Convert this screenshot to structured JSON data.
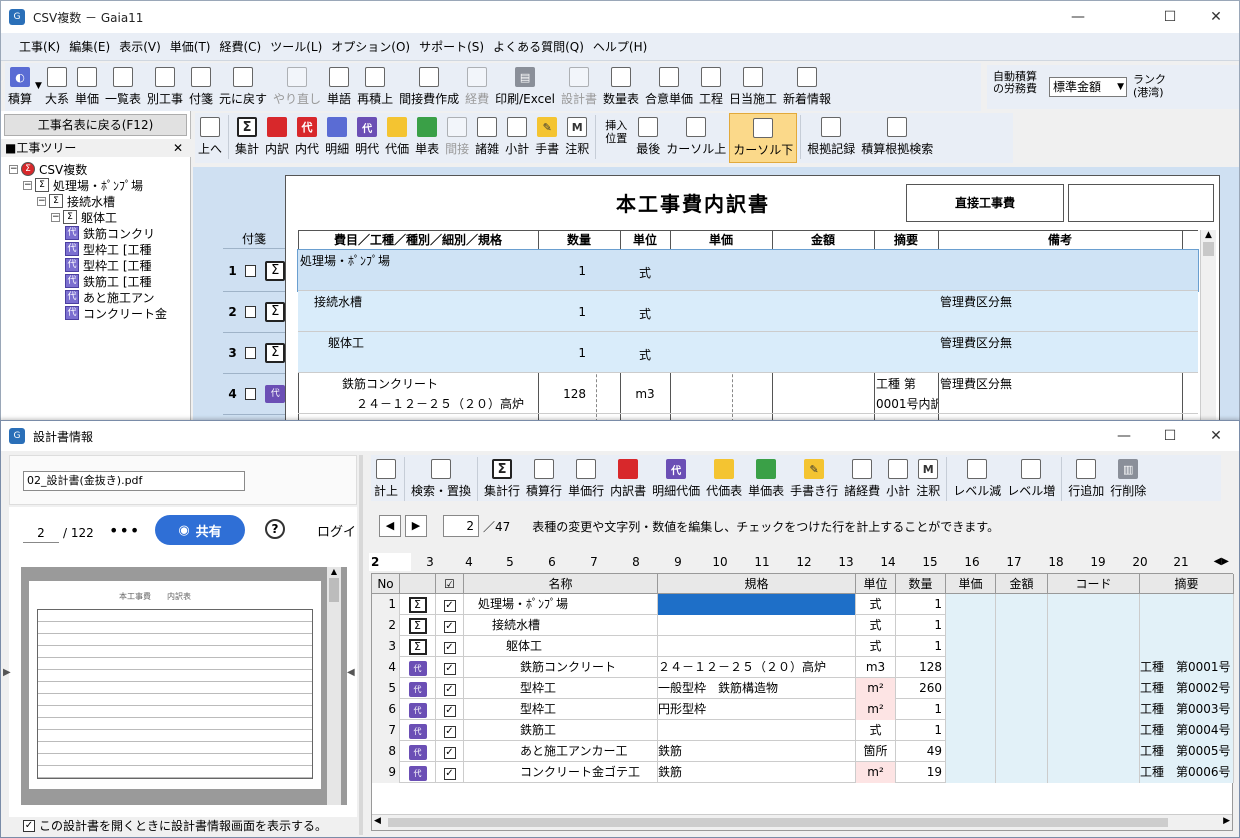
{
  "main_window": {
    "title": "CSV複数 － Gaia11",
    "menus": [
      "工事(K)",
      "編集(E)",
      "表示(V)",
      "単価(T)",
      "経費(C)",
      "ツール(L)",
      "オプション(O)",
      "サポート(S)",
      "よくある質問(Q)",
      "ヘルプ(H)"
    ],
    "toolbar1": [
      {
        "label": "積算",
        "icon": "globe-icon"
      },
      {
        "label": "大系",
        "icon": "tree-icon"
      },
      {
        "label": "単価",
        "icon": "price-icon"
      },
      {
        "label": "一覧表",
        "icon": "list-icon"
      },
      {
        "label": "別工事",
        "icon": "other-work-icon"
      },
      {
        "label": "付箋",
        "icon": "sticky-note-icon"
      },
      {
        "label": "元に戻す",
        "icon": "undo-icon"
      },
      {
        "label": "やり直し",
        "icon": "redo-icon",
        "disabled": true
      },
      {
        "label": "単語",
        "icon": "word-icon"
      },
      {
        "label": "再積上",
        "icon": "recalc-icon"
      },
      {
        "label": "間接費作成",
        "icon": "indirect-cost-icon"
      },
      {
        "label": "経費",
        "icon": "expense-icon",
        "disabled": true
      },
      {
        "label": "印刷/Excel",
        "icon": "printer-icon"
      },
      {
        "label": "設計書",
        "icon": "design-doc-icon",
        "disabled": true
      },
      {
        "label": "数量表",
        "icon": "quantity-table-icon"
      },
      {
        "label": "合意単価",
        "icon": "agreed-price-icon"
      },
      {
        "label": "工程",
        "icon": "schedule-icon"
      },
      {
        "label": "日当施工",
        "icon": "daily-work-icon"
      },
      {
        "label": "新着情報",
        "icon": "news-icon"
      }
    ],
    "auto_labor": {
      "label": "自動積算の労務費",
      "select_value": "標準金額",
      "rank_label": "ランク(港湾)"
    },
    "back_button": "工事名表に戻る(F12)",
    "tree_header": "■工事ツリー",
    "tree": [
      {
        "label": "CSV複数",
        "level": 0
      },
      {
        "label": "処理場・ﾎﾟﾝﾌﾟ場",
        "level": 1
      },
      {
        "label": "接続水槽",
        "level": 2
      },
      {
        "label": "躯体工",
        "level": 3
      },
      {
        "label": "鉄筋コンクリ",
        "level": 4
      },
      {
        "label": "型枠工 [工種",
        "level": 4
      },
      {
        "label": "型枠工 [工種",
        "level": 4
      },
      {
        "label": "鉄筋工 [工種",
        "level": 4
      },
      {
        "label": "あと施工アン",
        "level": 4
      },
      {
        "label": "コンクリート金",
        "level": 4
      }
    ],
    "toolbar2": [
      {
        "label": "上へ",
        "icon": "up-folder-icon"
      },
      {
        "label": "集計",
        "icon": "sigma-icon"
      },
      {
        "label": "内訳",
        "icon": "red-folder-icon"
      },
      {
        "label": "内代",
        "icon": "red-dai-icon"
      },
      {
        "label": "明細",
        "icon": "blue-folder-icon"
      },
      {
        "label": "明代",
        "icon": "blue-dai-icon"
      },
      {
        "label": "代価",
        "icon": "yellow-folder-icon"
      },
      {
        "label": "単表",
        "icon": "green-folder-icon"
      },
      {
        "label": "間接",
        "icon": "indirect-icon",
        "disabled": true
      },
      {
        "label": "諸雑",
        "icon": "misc-icon"
      },
      {
        "label": "小計",
        "icon": "subtotal-icon"
      },
      {
        "label": "手書",
        "icon": "pencil-icon"
      },
      {
        "label": "注釈",
        "icon": "memo-icon"
      },
      {
        "label": "挿入位置",
        "icon": ""
      },
      {
        "label": "最後",
        "icon": "last-icon"
      },
      {
        "label": "カーソル上",
        "icon": "cursor-up-icon"
      },
      {
        "label": "カーソル下",
        "icon": "cursor-down-icon",
        "active": true
      },
      {
        "label": "根拠記録",
        "icon": "evidence-icon"
      },
      {
        "label": "積算根拠検索",
        "icon": "evidence-search-icon"
      }
    ],
    "sheet": {
      "title": "本工事費内訳書",
      "box_label": "直接工事費",
      "fusen_label": "付箋",
      "headers": [
        "費目／工種／種別／細別／規格",
        "数量",
        "単位",
        "単価",
        "金額",
        "摘要",
        "備考"
      ],
      "rows": [
        {
          "no": "1",
          "name": "処理場・ﾎﾟﾝﾌﾟ場",
          "qty": "1",
          "unit": "式",
          "tekiyo": "",
          "biko": "",
          "icon": "sigma"
        },
        {
          "no": "2",
          "name": "接続水槽",
          "qty": "1",
          "unit": "式",
          "tekiyo": "",
          "biko": "管理費区分無",
          "icon": "sigma"
        },
        {
          "no": "3",
          "name": "躯体工",
          "qty": "1",
          "unit": "式",
          "tekiyo": "",
          "biko": "管理費区分無",
          "icon": "sigma"
        },
        {
          "no": "4",
          "name": "鉄筋コンクリート",
          "name2": "２４－１２－２５（２０）高炉",
          "qty": "128",
          "unit": "m3",
          "tekiyo": "工種 第",
          "tekiyo2": "0001号内訳",
          "biko": "管理費区分無",
          "icon": "dai"
        }
      ]
    }
  },
  "dialog": {
    "title": "設計書情報",
    "pdf_name": "02_設計書(金抜き).pdf",
    "page_current": "2",
    "page_total": "/ 122",
    "share_label": "共有",
    "login_label": "ログイ",
    "pdf_heading": "本工事費　　内訳表",
    "footer_checkbox": "この設計書を開くときに設計書情報画面を表示する。",
    "toolbar": [
      {
        "label": "計上",
        "icon": "post-icon"
      },
      {
        "label": "検索・置換",
        "icon": "search-replace-icon"
      },
      {
        "label": "集計行",
        "icon": "sigma-icon"
      },
      {
        "label": "積算行",
        "icon": "calc-row-icon"
      },
      {
        "label": "単価行",
        "icon": "price-row-icon"
      },
      {
        "label": "内訳書",
        "icon": "red-folder-icon"
      },
      {
        "label": "明細代価",
        "icon": "blue-dai-icon"
      },
      {
        "label": "代価表",
        "icon": "yellow-folder-icon"
      },
      {
        "label": "単価表",
        "icon": "green-folder-icon"
      },
      {
        "label": "手書き行",
        "icon": "pencil-icon"
      },
      {
        "label": "諸経費",
        "icon": "misc-icon"
      },
      {
        "label": "小計",
        "icon": "subtotal-icon"
      },
      {
        "label": "注釈",
        "icon": "memo-icon"
      },
      {
        "label": "レベル減",
        "icon": "level-down-icon"
      },
      {
        "label": "レベル増",
        "icon": "level-up-icon"
      },
      {
        "label": "行追加",
        "icon": "add-row-icon"
      },
      {
        "label": "行削除",
        "icon": "trash-icon"
      }
    ],
    "nav": {
      "page": "2",
      "total": "／47",
      "hint": "表種の変更や文字列・数値を編集し、チェックをつけた行を計上することができます。"
    },
    "col_tabs": [
      "2",
      "3",
      "4",
      "5",
      "6",
      "7",
      "8",
      "9",
      "10",
      "11",
      "12",
      "13",
      "14",
      "15",
      "16",
      "17",
      "18",
      "19",
      "20",
      "21"
    ],
    "grid_headers": [
      "No",
      "",
      "☑",
      "名称",
      "規格",
      "単位",
      "数量",
      "単価",
      "金額",
      "コード",
      "摘要"
    ],
    "grid_rows": [
      {
        "no": "1",
        "icon": "sigma",
        "name": "処理場・ﾎﾟﾝﾌﾟ場",
        "indent": 0,
        "spec": "",
        "unit": "式",
        "qty": "1",
        "tekiyo": ""
      },
      {
        "no": "2",
        "icon": "sigma",
        "name": "接続水槽",
        "indent": 1,
        "spec": "",
        "unit": "式",
        "qty": "1",
        "tekiyo": ""
      },
      {
        "no": "3",
        "icon": "sigma",
        "name": "躯体工",
        "indent": 2,
        "spec": "",
        "unit": "式",
        "qty": "1",
        "tekiyo": ""
      },
      {
        "no": "4",
        "icon": "dai",
        "name": "鉄筋コンクリート",
        "indent": 3,
        "spec": "２４－１２－２５（２０）高炉",
        "unit": "m3",
        "qty": "128",
        "tekiyo": "工種　第0001号"
      },
      {
        "no": "5",
        "icon": "dai",
        "name": "型枠工",
        "indent": 3,
        "spec": "一般型枠　鉄筋構造物",
        "unit": "m²",
        "qty": "260",
        "tekiyo": "工種　第0002号"
      },
      {
        "no": "6",
        "icon": "dai",
        "name": "型枠工",
        "indent": 3,
        "spec": "円形型枠",
        "unit": "m²",
        "qty": "1",
        "tekiyo": "工種　第0003号"
      },
      {
        "no": "7",
        "icon": "dai",
        "name": "鉄筋工",
        "indent": 3,
        "spec": "",
        "unit": "式",
        "qty": "1",
        "tekiyo": "工種　第0004号"
      },
      {
        "no": "8",
        "icon": "dai",
        "name": "あと施工アンカー工",
        "indent": 3,
        "spec": "鉄筋",
        "unit": "箇所",
        "qty": "49",
        "tekiyo": "工種　第0005号"
      },
      {
        "no": "9",
        "icon": "dai",
        "name": "コンクリート金ゴテ工",
        "indent": 3,
        "spec": "鉄筋",
        "unit": "m²",
        "qty": "19",
        "tekiyo": "工種　第0006号"
      }
    ]
  }
}
